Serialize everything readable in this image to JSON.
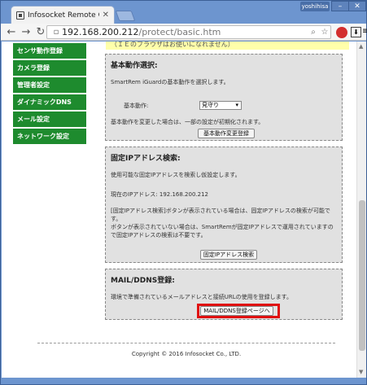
{
  "browser": {
    "tab_title": "Infosocket Remote Co",
    "user_badge": "yoshihisa",
    "url_host": "192.168.200.212",
    "url_path": "/protect/basic.htm"
  },
  "page": {
    "notice_partial": "（ＩＥのブラウザはお使いになれません）",
    "sidebar": {
      "items": [
        {
          "label": "センサ動作登録"
        },
        {
          "label": "カメラ登録"
        },
        {
          "label": "管理者設定"
        },
        {
          "label": "ダイナミックDNS"
        },
        {
          "label": "メール設定"
        },
        {
          "label": "ネットワーク設定"
        }
      ]
    },
    "basic": {
      "title": "基本動作選択:",
      "desc": "SmartRem iGuardの基本動作を選択します。",
      "label": "基本動作:",
      "select_value": "見守り",
      "note": "基本動作を変更した場合は、一部の設定が初期化されます。",
      "button": "基本動作変更登録"
    },
    "fixed_ip": {
      "title": "固定IPアドレス検索:",
      "desc": "使用可能な固定IPアドレスを検索し仮設定します。",
      "current": "現在のIPアドレス: 192.168.200.212",
      "note1": "[固定IPアドレス検索]ボタンが表示されている場合は、固定IPアドレスの検索が可能です。",
      "note2": "ボタンが表示されていない場合は、SmartRemが固定IPアドレスで運用されていますので固定IPアドレスの検索は不要です。",
      "button": "固定IPアドレス検索"
    },
    "mail_ddns": {
      "title": "MAIL/DDNS登録:",
      "desc": "環境で準備されているメールアドレスと接続URLの使用を登録します。",
      "button": "MAIL/DDNS登録ページへ"
    },
    "footer": {
      "copyright": "Copyright © 2016 Infosocket Co., LTD."
    }
  },
  "colors": {
    "sidebar_green": "#1e8b2e",
    "section_gray": "#e1e1e1",
    "highlight_red": "#e01010",
    "browser_frame": "#6d95cf"
  }
}
